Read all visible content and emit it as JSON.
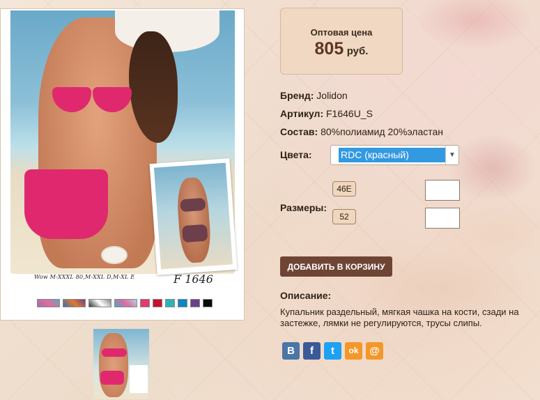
{
  "product_image": {
    "caption": "Wow  M-XXXL 80,M-XXL D,M-XL E",
    "model_number": "F 1646",
    "swatch_colors": [
      "#e23b6e",
      "#c8102e",
      "#2bb3b8",
      "#0e86c4",
      "#6b3f8c",
      "#0a0a0a"
    ]
  },
  "price": {
    "label": "Оптовая цена",
    "value": "805",
    "currency": "руб."
  },
  "details": {
    "brand_label": "Бренд:",
    "brand_value": "Jolidon",
    "article_label": "Артикул:",
    "article_value": "F1646U_S",
    "composition_label": "Состав:",
    "composition_value": "80%полиамид 20%эластан"
  },
  "colors": {
    "label": "Цвета:",
    "selected": "RDC (красный)"
  },
  "sizes": {
    "label": "Размеры:",
    "items": [
      {
        "size": "46E",
        "qty": ""
      },
      {
        "size": "52",
        "qty": ""
      }
    ]
  },
  "cart": {
    "button_label": "ДОБАВИТЬ В КОРЗИНУ"
  },
  "description": {
    "label": "Описание:",
    "text": "Купальник раздельный, мягкая чашка на кости, сзади на застежке, лямки не регулируются, трусы слипы."
  },
  "share": [
    {
      "name": "vk-icon",
      "glyph": "B",
      "color": "#4a76a8"
    },
    {
      "name": "facebook-icon",
      "glyph": "f",
      "color": "#3b5998"
    },
    {
      "name": "twitter-icon",
      "glyph": "t",
      "color": "#1da1f2"
    },
    {
      "name": "odnoklassniki-icon",
      "glyph": "ok",
      "color": "#f2982a"
    },
    {
      "name": "mail-icon",
      "glyph": "@",
      "color": "#f2982a"
    }
  ]
}
